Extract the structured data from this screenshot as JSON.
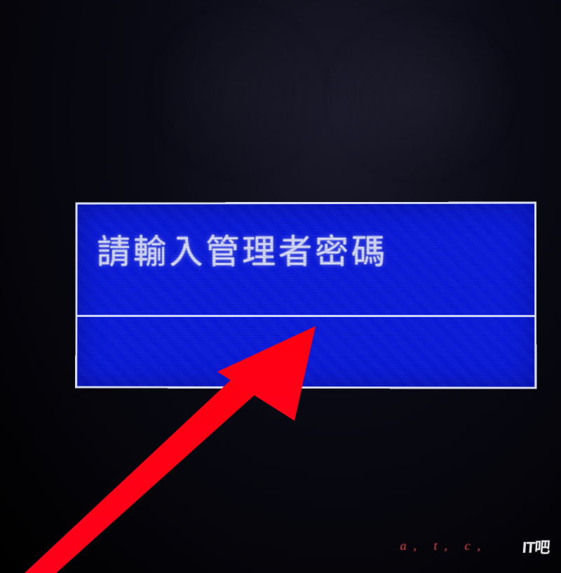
{
  "dialog": {
    "title": "請輸入管理者密碼",
    "password_value": ""
  },
  "annotation": {
    "arrow_color": "#ff0015"
  },
  "watermark": {
    "left_text": "a, t, c,",
    "right_text": "IT吧"
  },
  "colors": {
    "dialog_bg": "#0c1ce0",
    "dialog_border": "#d8dcf0",
    "text": "#eef0ff"
  }
}
